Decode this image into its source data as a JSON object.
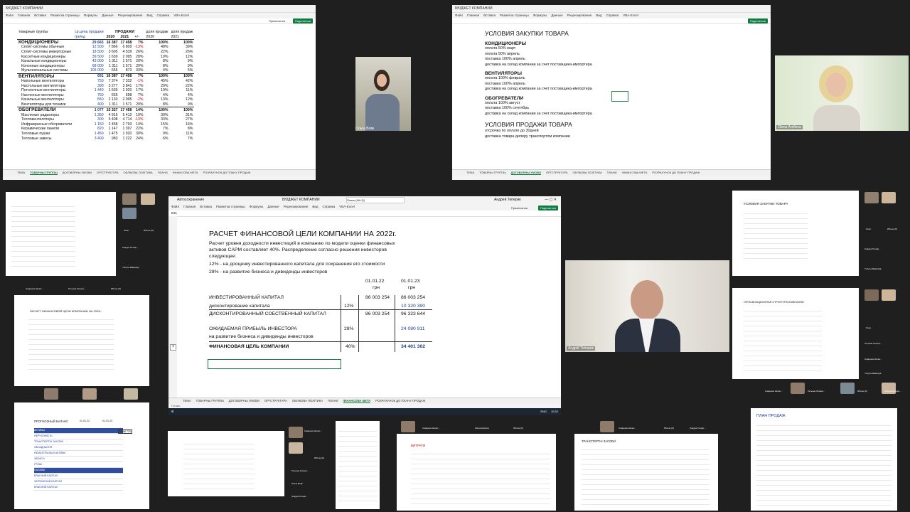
{
  "tile1": {
    "title": "БЮДЖЕТ КОМПАНИИ",
    "user": "Андрей Теперик",
    "menu": [
      "Файл",
      "Главная",
      "Вставка",
      "Разметка страницы",
      "Формулы",
      "Данные",
      "Рецензирование",
      "Вид",
      "Справка",
      "VBA-Excel"
    ],
    "btn_comments": "Примечания",
    "btn_share": "Поделиться",
    "headers": {
      "groups": "товарные группы",
      "avg": "ср.цена продажи",
      "sales": "ПРОДАЖИ",
      "share_sales": "доля продаж",
      "y2020": "2020",
      "y2021": "2021",
      "pm": "+/-",
      "unit_grn": "грн/ед",
      "sht": "шт",
      "pct": "%"
    },
    "rows": [
      [
        "КОНДИЦИОНЕРЫ",
        "29 665",
        "16 387",
        "17 458",
        "7%",
        "100%",
        "100%"
      ],
      [
        "Сплит-системы обычные",
        "12 500",
        "7 866",
        "6 809",
        "-13%",
        "48%",
        "39%"
      ],
      [
        "Сплит-системы инверторные",
        "18 500",
        "3 605",
        "4 539",
        "26%",
        "22%",
        "26%"
      ],
      [
        "Кассетные кондиционеры",
        "39 500",
        "1 639",
        "2 095",
        "28%",
        "10%",
        "12%"
      ],
      [
        "Канальные кондиционеры",
        "43 000",
        "1 311",
        "1 571",
        "20%",
        "8%",
        "9%"
      ],
      [
        "Колонные кондиционеры",
        "68 000",
        "1 311",
        "1 571",
        "20%",
        "8%",
        "9%"
      ],
      [
        "Мультизональные системы",
        "105 000",
        "655",
        "873",
        "33%",
        "4%",
        "5%"
      ],
      [
        "ВЕНТИЛЯТОРЫ",
        "691",
        "16 387",
        "17 458",
        "7%",
        "100%",
        "100%"
      ],
      [
        "Напольные вентиляторы",
        "750",
        "7 374",
        "7 332",
        "-1%",
        "45%",
        "42%"
      ],
      [
        "Настольные вентиляторы",
        "390",
        "3 277",
        "3 841",
        "17%",
        "20%",
        "22%"
      ],
      [
        "Потолочные вентиляторы",
        "1 440",
        "1 639",
        "1 920",
        "17%",
        "10%",
        "11%"
      ],
      [
        "Настенные вентиляторы",
        "750",
        "655",
        "698",
        "7%",
        "4%",
        "4%"
      ],
      [
        "Канальные вентиляторы",
        "550",
        "2 130",
        "2 095",
        "-2%",
        "13%",
        "12%"
      ],
      [
        "Вентиляторы для техники",
        "400",
        "1 311",
        "1 571",
        "20%",
        "8%",
        "9%"
      ],
      [
        "ОБОГРЕВАТЕЛИ",
        "1 077",
        "15 327",
        "17 458",
        "14%",
        "100%",
        "100%"
      ],
      [
        "Масляные радиаторы",
        "1 350",
        "4 916",
        "5 412",
        "10%",
        "30%",
        "31%"
      ],
      [
        "Тепловентиляторы",
        "300",
        "5 408",
        "4 714",
        "-13%",
        "33%",
        "27%"
      ],
      [
        "Инфракрасные обогреватели",
        "1 150",
        "2 458",
        "2 793",
        "14%",
        "15%",
        "16%"
      ],
      [
        "Керамические панели",
        "820",
        "1 147",
        "1 397",
        "22%",
        "7%",
        "8%"
      ],
      [
        "Тепловые пушки",
        "1 450",
        "1 475",
        "1 920",
        "30%",
        "9%",
        "11%"
      ],
      [
        "Тепловые завесы",
        "3 400",
        "983",
        "1 222",
        "24%",
        "6%",
        "7%"
      ]
    ],
    "tabs": [
      "ТЕМА",
      "ТОВАРНЫ ГРУППЫ",
      "ДОГОВОРНЫ УМОВИ",
      "ОРГСТРУКТУРА",
      "ОБЛІКОВА ПОЛІТИКА",
      "ПЛАНИ",
      "ФІНАНСОВА МЕТА",
      "РОЗРАХУНОК ДО ПЛАНУ ПРОДАЖ"
    ],
    "active_tab": "ТОВАРНЫ ГРУППЫ"
  },
  "video_olga": {
    "name": "Ольга Вовк"
  },
  "tile2": {
    "title": "БЮДЖЕТ КОМПАНИИ",
    "user": "Андрей Теперик",
    "heading1": "УСЛОВИЯ ЗАКУПКИ ТОВАРА",
    "sections": [
      {
        "title": "КОНДИЦИОНЕРЫ",
        "lines": [
          "оплата 50% март",
          "оплата 50% апрель",
          "поставка 100% апрель",
          "доставка на склад компании за счет поставщика-импортера"
        ]
      },
      {
        "title": "ВЕНТИЛЯТОРЫ",
        "lines": [
          "оплата 100% февраль",
          "поставка 100% апрель",
          "доставка на склад компании за счет поставщика-импортера"
        ]
      },
      {
        "title": "ОБОГРЕВАТЕЛИ",
        "lines": [
          "оплата 100% август",
          "поставка 100% сентябрь",
          "доставка на склад компании за счет поставщика-импортера"
        ]
      }
    ],
    "heading2": "УСЛОВИЯ ПРОДАЖИ ТОВАРА",
    "sale_lines": [
      "отсрочка по оплате до 30дней",
      "доставка товара дилеру транспортом компании"
    ],
    "tabs": [
      "ТЕМА",
      "ТОВАРНЫ ГРУППЫ",
      "ДОГОВОРНЫ УМОВИ",
      "ОРГСТРУКТУРА",
      "ОБЛІКОВА ПОЛІТИКА",
      "ПЛАНИ",
      "ФІНАНСОВА МЕТА",
      "РОЗРАХУНОК ДО ПЛАНУ ПРОДАЖ"
    ],
    "active_tab": "ДОГОВОРНЫ УМОВИ"
  },
  "video_olena": {
    "name": "Olena Arefieva"
  },
  "main": {
    "window_title": "БЮДЖЕТ КОМПАНИИ",
    "search": "Поиск (Alt+Q)",
    "user": "Андрей Теперик",
    "autosave": "Автосохранение",
    "menu": [
      "Файл",
      "Главная",
      "Вставка",
      "Разметка страницы",
      "Формулы",
      "Данные",
      "Рецензирование",
      "Вид",
      "Справка",
      "VBA-Excel"
    ],
    "btn_comments": "Примечания",
    "btn_share": "Поделиться",
    "cell_ref": "E31",
    "title": "РАСЧЕТ ФИНАНСОВОЙ ЦЕЛИ КОМПАНИИ НА 2022г.",
    "desc1": "Расчет уровня доходности инвестиций в компанию по модели оценки финансовых",
    "desc2": "активов CAPM составляет 40%. Распределение согласно решения инвесторов",
    "desc3": "следующее:",
    "desc4": "12% - на дооценку инвестированного капитала для сохранения его стоимости",
    "desc5": "28% - на развитие бизнеса и дивиденды инвесторов",
    "date1": "01.01.22",
    "date2": "01.01.23",
    "cur": "грн",
    "r1_label": "ИНВЕСТИРОВАННЫЙ КАПИТАЛ",
    "r1_v1": "86 003 254",
    "r1_v2": "86 003 254",
    "r2_label": "дисконтирование капитала",
    "r2_pct": "12%",
    "r2_v2": "10 320 390",
    "r3_label": "ДИСКОНТИРОВАННЫЙ СОБСТВЕННЫЙ КАПИТАЛ",
    "r3_v1": "86 003 254",
    "r3_v2": "96 323 644",
    "r4_label": "ОЖИДАЕМАЯ ПРИБЫЛЬ ИНВЕСТОРА",
    "r4_pct": "28%",
    "r4_v2": "24 080 911",
    "r5_label": "на развитие бизнеса и дивиденды инвесторов",
    "r6_label": "ФИНАНСОВАЯ ЦЕЛЬ КОМПАНИИ",
    "r6_pct": "40%",
    "r6_v2": "34 401 302",
    "tabs": [
      "ТЕМА",
      "ТОВАРНЫ ГРУППЫ",
      "ДОГОВОРНЫ УМОВИ",
      "ОРГСТРУКТУРА",
      "ОБЛІКОВА ПОЛІТИКА",
      "ПЛАНИ",
      "ФІНАНСОВА МЕТА",
      "РОЗРАХУНОК ДО ПЛАНУ ПРОДАЖ"
    ],
    "active_tab": "ФІНАНСОВА МЕТА",
    "status": "Готово",
    "clock": "10:32",
    "lang": "ENG"
  },
  "video_andrii": {
    "name": "Андрій Теперик"
  },
  "small": {
    "n1": "Сафонов Натал...",
    "n2": "Тетьяна Олексо...",
    "n3": "iPhone (9)",
    "n4": "Ольга Вовк",
    "n5": "Olena Arefieva",
    "n6": "Сакура Телеф...",
    "n7": "Yuriyna Malashyk",
    "n8": "Marina Andriienko",
    "n9": "Оксана Петрен...",
    "n10": "Ірина",
    "n11": "Лоза",
    "b1_title": "ПРОГНОЗНЫЙ БАЛАНС",
    "b1_d1": "01.01.22",
    "b1_d2": "01.01.23",
    "b1_val": "1 588 720",
    "b1_rows": [
      "АКТИВЫ",
      "НЕРУХОМІСТЬ",
      "ТРАНСПОРТНІ ЗАСОБИ",
      "ОБЛАДНАННЯ",
      "НЕМАТЕРІАЛЬНІ АКТИВИ",
      "ЗАПАСИ",
      "ГРОШІ",
      "ПАСИВИ",
      "ВЛАСНИЙ КАПІТАЛ",
      "ЗАТРАЧЕНИЙ КАПІТАЛ",
      "ВЛАСНИЙ КАПІТАЛ"
    ],
    "org_title": "ОРГАНИЗАЦИОННАЯ СТРУКТУРА КОМПАНИИ",
    "plan_title": "ПЛАН ПРОДАЖ",
    "rozr_title": "ВИТРАТИ",
    "tz_title": "ТРАНСПОРТНІ ЗАСОБИ"
  },
  "taskbar_time": "10:32"
}
